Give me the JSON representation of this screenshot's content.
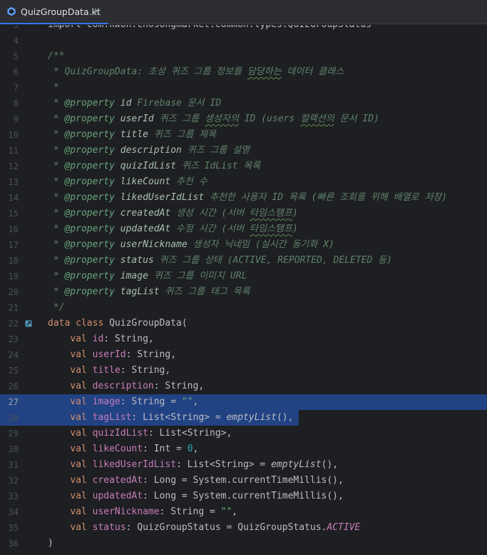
{
  "tab": {
    "title": "QuizGroupData.kt",
    "close": "×"
  },
  "colors": {
    "selection": "#214283",
    "accent": "#3574f0",
    "background": "#1e1f22"
  },
  "icons": {
    "tab": "kotlin-file-icon",
    "gutter": "implement-icon",
    "close": "close-icon"
  },
  "lines": [
    {
      "num": "3",
      "tokens": [
        [
          "plain",
          "import com.kwon.chosongmarket.common.types.QuizGroupStatus"
        ]
      ]
    },
    {
      "num": "4",
      "tokens": []
    },
    {
      "num": "5",
      "tokens": [
        [
          "doc",
          "/**"
        ]
      ]
    },
    {
      "num": "6",
      "tokens": [
        [
          "doc",
          " * QuizGroupData: 초성 퀴즈 그룹 정보를 담당하는 데이터 클래스"
        ]
      ]
    },
    {
      "num": "7",
      "tokens": [
        [
          "doc",
          " *"
        ]
      ]
    },
    {
      "num": "8",
      "tokens": [
        [
          "doc",
          " * "
        ],
        [
          "tag",
          "@property"
        ],
        [
          "docref",
          " id"
        ],
        [
          "doc",
          " Firebase 문서 ID"
        ]
      ]
    },
    {
      "num": "9",
      "tokens": [
        [
          "doc",
          " * "
        ],
        [
          "tag",
          "@property"
        ],
        [
          "docref",
          " userId"
        ],
        [
          "doc",
          " 퀴즈 그룹 생성자의 ID (users 컬렉션의 문서 ID)"
        ]
      ]
    },
    {
      "num": "10",
      "tokens": [
        [
          "doc",
          " * "
        ],
        [
          "tag",
          "@property"
        ],
        [
          "docref",
          " title"
        ],
        [
          "doc",
          " 퀴즈 그룹 제목"
        ]
      ]
    },
    {
      "num": "11",
      "tokens": [
        [
          "doc",
          " * "
        ],
        [
          "tag",
          "@property"
        ],
        [
          "docref",
          " description"
        ],
        [
          "doc",
          " 퀴즈 그룹 설명"
        ]
      ]
    },
    {
      "num": "12",
      "tokens": [
        [
          "doc",
          " * "
        ],
        [
          "tag",
          "@property"
        ],
        [
          "docref",
          " quizIdList"
        ],
        [
          "doc",
          " 퀴즈 IdList 목록"
        ]
      ]
    },
    {
      "num": "13",
      "tokens": [
        [
          "doc",
          " * "
        ],
        [
          "tag",
          "@property"
        ],
        [
          "docref",
          " likeCount"
        ],
        [
          "doc",
          " 추천 수"
        ]
      ]
    },
    {
      "num": "14",
      "tokens": [
        [
          "doc",
          " * "
        ],
        [
          "tag",
          "@property"
        ],
        [
          "docref",
          " likedUserIdList"
        ],
        [
          "doc",
          " 추천한 사용자 ID 목록 (빠른 조회를 위해 배열로 저장)"
        ]
      ]
    },
    {
      "num": "15",
      "tokens": [
        [
          "doc",
          " * "
        ],
        [
          "tag",
          "@property"
        ],
        [
          "docref",
          " createdAt"
        ],
        [
          "doc",
          " 생성 시간 (서버 타임스탬프)"
        ]
      ]
    },
    {
      "num": "16",
      "tokens": [
        [
          "doc",
          " * "
        ],
        [
          "tag",
          "@property"
        ],
        [
          "docref",
          " updatedAt"
        ],
        [
          "doc",
          " 수정 시간 (서버 타임스탬프)"
        ]
      ]
    },
    {
      "num": "17",
      "tokens": [
        [
          "doc",
          " * "
        ],
        [
          "tag",
          "@property"
        ],
        [
          "docref",
          " userNickname"
        ],
        [
          "doc",
          " 생성자 닉네임 (실시간 동기화 X)"
        ]
      ]
    },
    {
      "num": "18",
      "tokens": [
        [
          "doc",
          " * "
        ],
        [
          "tag",
          "@property"
        ],
        [
          "docref",
          " status"
        ],
        [
          "doc",
          " 퀴즈 그룹 상태 (ACTIVE, REPORTED, DELETED 등)"
        ]
      ]
    },
    {
      "num": "19",
      "tokens": [
        [
          "doc",
          " * "
        ],
        [
          "tag",
          "@property"
        ],
        [
          "docref",
          " image"
        ],
        [
          "doc",
          " 퀴즈 그룹 이미지 URL"
        ]
      ]
    },
    {
      "num": "20",
      "tokens": [
        [
          "doc",
          " * "
        ],
        [
          "tag",
          "@property"
        ],
        [
          "docref",
          " tagList"
        ],
        [
          "doc",
          " 퀴즈 그룹 태그 목록"
        ]
      ]
    },
    {
      "num": "21",
      "tokens": [
        [
          "doc",
          " */"
        ]
      ]
    },
    {
      "num": "22",
      "tokens": [
        [
          "kw",
          "data class "
        ],
        [
          "plain",
          "QuizGroupData("
        ]
      ],
      "gutter_icon": true
    },
    {
      "num": "23",
      "tokens": [
        [
          "plain",
          "    "
        ],
        [
          "kw",
          "val "
        ],
        [
          "prop",
          "id"
        ],
        [
          "plain",
          ": String,"
        ]
      ]
    },
    {
      "num": "24",
      "tokens": [
        [
          "plain",
          "    "
        ],
        [
          "kw",
          "val "
        ],
        [
          "prop",
          "userId"
        ],
        [
          "plain",
          ": String,"
        ]
      ]
    },
    {
      "num": "25",
      "tokens": [
        [
          "plain",
          "    "
        ],
        [
          "kw",
          "val "
        ],
        [
          "prop",
          "title"
        ],
        [
          "plain",
          ": String,"
        ]
      ]
    },
    {
      "num": "26",
      "tokens": [
        [
          "plain",
          "    "
        ],
        [
          "kw",
          "val "
        ],
        [
          "prop",
          "description"
        ],
        [
          "plain",
          ": String,"
        ]
      ]
    },
    {
      "num": "27",
      "tokens": [
        [
          "plain",
          "    "
        ],
        [
          "kw",
          "val "
        ],
        [
          "prop",
          "image"
        ],
        [
          "plain",
          ": String = "
        ],
        [
          "str",
          "\"\""
        ],
        [
          "plain",
          ","
        ]
      ],
      "selected": "full",
      "current": true
    },
    {
      "num": "28",
      "tokens": [
        [
          "plain",
          "    "
        ],
        [
          "kw",
          "val "
        ],
        [
          "prop",
          "tagList"
        ],
        [
          "plain",
          ": List<String> = "
        ],
        [
          "fn-it",
          "emptyList"
        ],
        [
          "plain",
          "(),"
        ]
      ],
      "selected": "partial"
    },
    {
      "num": "29",
      "tokens": [
        [
          "plain",
          "    "
        ],
        [
          "kw",
          "val "
        ],
        [
          "prop",
          "quizIdList"
        ],
        [
          "plain",
          ": List<String>,"
        ]
      ]
    },
    {
      "num": "30",
      "tokens": [
        [
          "plain",
          "    "
        ],
        [
          "kw",
          "val "
        ],
        [
          "prop",
          "likeCount"
        ],
        [
          "plain",
          ": Int = "
        ],
        [
          "num",
          "0"
        ],
        [
          "plain",
          ","
        ]
      ]
    },
    {
      "num": "31",
      "tokens": [
        [
          "plain",
          "    "
        ],
        [
          "kw",
          "val "
        ],
        [
          "prop",
          "likedUserIdList"
        ],
        [
          "plain",
          ": List<String> = "
        ],
        [
          "fn-it",
          "emptyList"
        ],
        [
          "plain",
          "(),"
        ]
      ]
    },
    {
      "num": "32",
      "tokens": [
        [
          "plain",
          "    "
        ],
        [
          "kw",
          "val "
        ],
        [
          "prop",
          "createdAt"
        ],
        [
          "plain",
          ": Long = System.currentTimeMillis(),"
        ]
      ]
    },
    {
      "num": "33",
      "tokens": [
        [
          "plain",
          "    "
        ],
        [
          "kw",
          "val "
        ],
        [
          "prop",
          "updatedAt"
        ],
        [
          "plain",
          ": Long = System.currentTimeMillis(),"
        ]
      ]
    },
    {
      "num": "34",
      "tokens": [
        [
          "plain",
          "    "
        ],
        [
          "kw",
          "val "
        ],
        [
          "prop",
          "userNickname"
        ],
        [
          "plain",
          ": String = "
        ],
        [
          "str",
          "\"\""
        ],
        [
          "plain",
          ","
        ]
      ]
    },
    {
      "num": "35",
      "tokens": [
        [
          "plain",
          "    "
        ],
        [
          "kw",
          "val "
        ],
        [
          "prop",
          "status"
        ],
        [
          "plain",
          ": QuizGroupStatus = QuizGroupStatus."
        ],
        [
          "enum",
          "ACTIVE"
        ]
      ]
    },
    {
      "num": "36",
      "tokens": [
        [
          "plain",
          ")"
        ]
      ]
    }
  ]
}
